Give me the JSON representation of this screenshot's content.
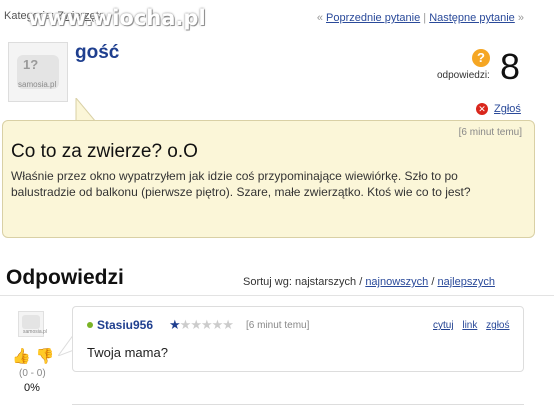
{
  "category": {
    "label": "Kategoria:",
    "value": "Zwierzęta"
  },
  "watermark": "www.wiocha.pl",
  "topnav": {
    "prev": "Poprzednie pytanie",
    "separator": "|",
    "next": "Następne pytanie",
    "prev_arrow": "«",
    "next_arrow": "»"
  },
  "author": {
    "name": "gość",
    "avatar_label": "samosia.pl",
    "avatar_mark": "1?"
  },
  "stats": {
    "icon": "question-icon",
    "label": "odpowiedzi:",
    "count": "8"
  },
  "report": {
    "label": "Zgłoś",
    "icon": "x-circle-icon"
  },
  "question": {
    "time": "[6 minut temu]",
    "title": "Co to za zwierze? o.O",
    "body": "Właśnie przez okno wypatrzyłem jak idzie coś przypominające wiewiórkę. Szło to po balustradzie od balkonu (pierwsze piętro). Szare, małe zwierzątko. Ktoś wie co to jest?"
  },
  "answers": {
    "heading": "Odpowiedzi",
    "sort": {
      "label": "Sortuj wg:",
      "options": [
        "najstarszych",
        "najnowszych",
        "najlepszych"
      ],
      "selected": "najstarszych",
      "separator": "/"
    },
    "items": [
      {
        "user": "Stasiu956",
        "avatar_label": "samosia.pl",
        "avatar_mark": "1?",
        "rating": 0.5,
        "rating_max": 6,
        "time": "[6 minut temu]",
        "actions": [
          "cytuj",
          "link",
          "zgłoś"
        ],
        "text": "Twoja mama?",
        "votes": "(0 - 0)",
        "percent": "0%"
      }
    ]
  },
  "colors": {
    "accent": "#1f3f8f",
    "bubble": "#fbf6d8",
    "bubble_border": "#d9d0a5",
    "report": "#d9261c",
    "question_icon": "#f5a623"
  }
}
